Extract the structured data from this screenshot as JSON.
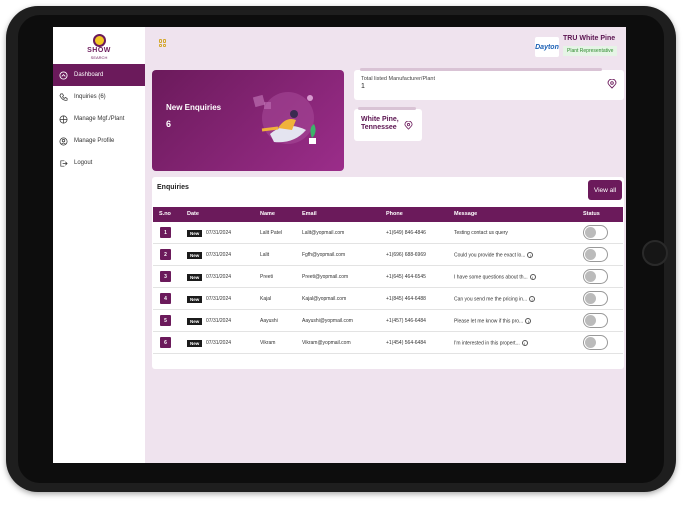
{
  "sidebar": {
    "logo_text": "SHOW",
    "logo_sub": "SEARCH",
    "items": [
      {
        "label": "Dashboard",
        "icon": "dashboard-icon",
        "active": true
      },
      {
        "label": "Inquiries (6)",
        "icon": "phone-icon",
        "active": false
      },
      {
        "label": "Manage Mgf./Plant",
        "icon": "plant-icon",
        "active": false
      },
      {
        "label": "Manage Profile",
        "icon": "user-circle-icon",
        "active": false
      },
      {
        "label": "Logout",
        "icon": "logout-icon",
        "active": false
      }
    ]
  },
  "header": {
    "brand_logo": "Dayton",
    "brand_name": "TRU White Pine",
    "brand_role": "Plant Representative"
  },
  "cards": {
    "new_enquiries_label": "New Enquiries",
    "new_enquiries_count": "6",
    "total_label": "Total listed Manufacturer/Plant",
    "total_count": "1",
    "location": "White Pine, Tennessee"
  },
  "enquiries": {
    "title": "Enquiries",
    "view_all": "View all",
    "columns": [
      "S.no",
      "Date",
      "Name",
      "Email",
      "Phone",
      "Message",
      "Status"
    ],
    "badge": "New",
    "rows": [
      {
        "sno": "1",
        "date": "07/31/2024",
        "name": "Lalit Patel",
        "email": "Lalit@yopmail.com",
        "phone": "+1(649) 846-4846",
        "message": "Testing contact us query",
        "info": false
      },
      {
        "sno": "2",
        "date": "07/31/2024",
        "name": "Lalit",
        "email": "Fgfh@yopmail.com",
        "phone": "+1(696) 688-6969",
        "message": "Could you provide the exact lo...",
        "info": true
      },
      {
        "sno": "3",
        "date": "07/31/2024",
        "name": "Preeti",
        "email": "Preeti@yopmail.com",
        "phone": "+1(645) 464-6545",
        "message": "I have some questions about th...",
        "info": true
      },
      {
        "sno": "4",
        "date": "07/31/2024",
        "name": "Kajal",
        "email": "Kajal@yopmail.com",
        "phone": "+1(845) 464-6488",
        "message": "Can you send me the pricing in...",
        "info": true
      },
      {
        "sno": "5",
        "date": "07/31/2024",
        "name": "Aayushi",
        "email": "Aayushi@yopmail.com",
        "phone": "+1(457) 546-6484",
        "message": "Please let me know if this pro...",
        "info": true
      },
      {
        "sno": "6",
        "date": "07/31/2024",
        "name": "Vikram",
        "email": "Vikram@yopmail.com",
        "phone": "+1(454) 564-6484",
        "message": "I'm interested in this propert...",
        "info": true
      }
    ]
  },
  "colors": {
    "accent": "#6b1a5b",
    "background": "#efe3ee",
    "brand_role": "#2e8b2e"
  }
}
